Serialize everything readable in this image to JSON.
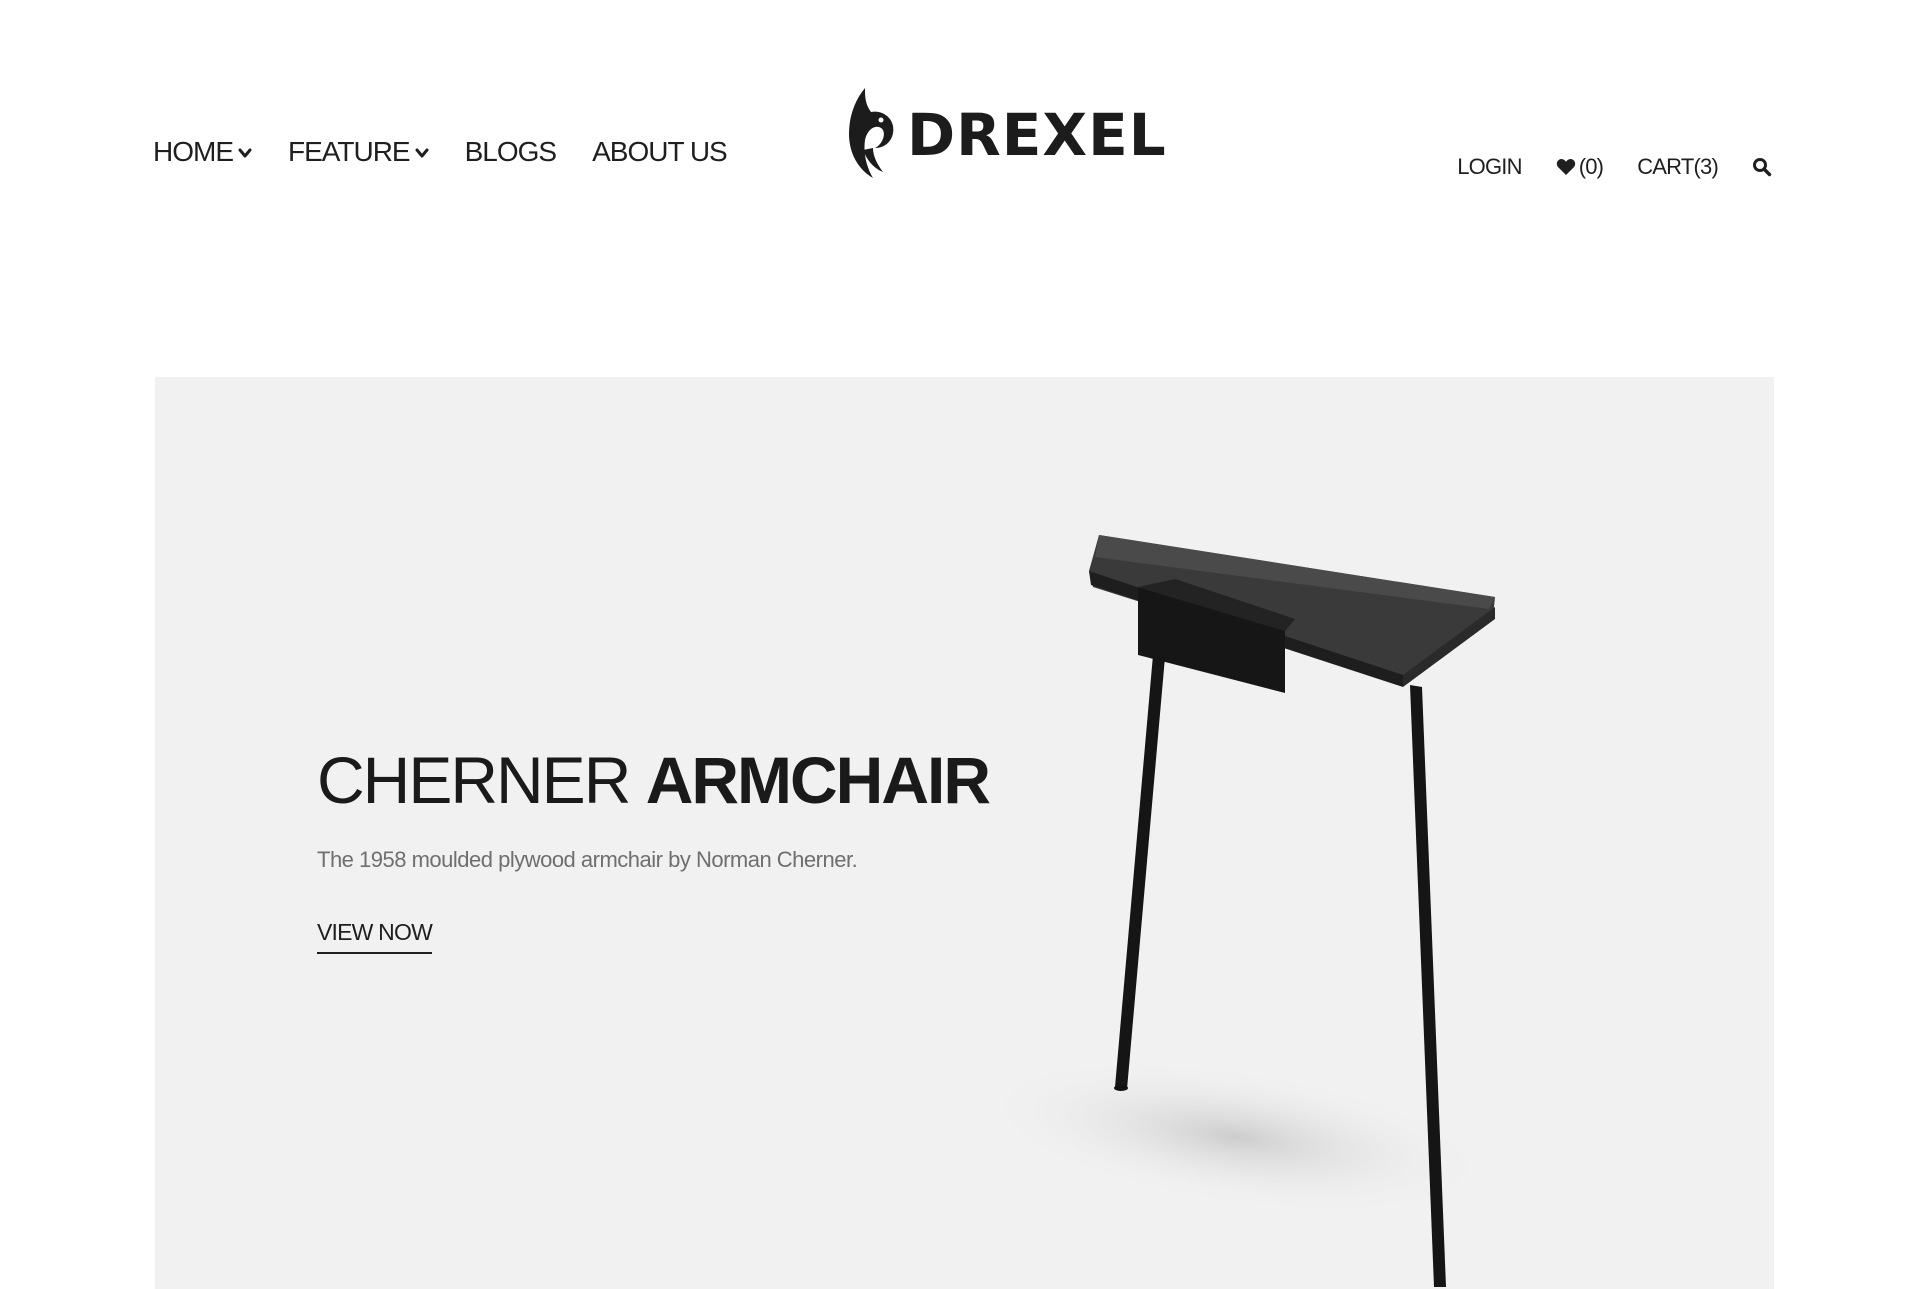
{
  "header": {
    "nav": [
      {
        "label": "HOME",
        "has_dropdown": true
      },
      {
        "label": "FEATURE",
        "has_dropdown": true
      },
      {
        "label": "BLOGS",
        "has_dropdown": false
      },
      {
        "label": "ABOUT US",
        "has_dropdown": false
      }
    ],
    "logo_text": "DREXEL",
    "utility": {
      "login_label": "LOGIN",
      "wishlist_count": "(0)",
      "cart_label": "CART(3)",
      "icons": [
        "heart-icon",
        "search-icon",
        "chevron-down-icon"
      ]
    }
  },
  "hero": {
    "title_light": "CHERNER ",
    "title_bold": "ARMCHAIR",
    "subtitle": "The 1958 moulded plywood armchair by Norman Cherner.",
    "cta_label": "VIEW NOW",
    "background_color": "#f1f1f1",
    "product_color": "#1c1c1c"
  }
}
